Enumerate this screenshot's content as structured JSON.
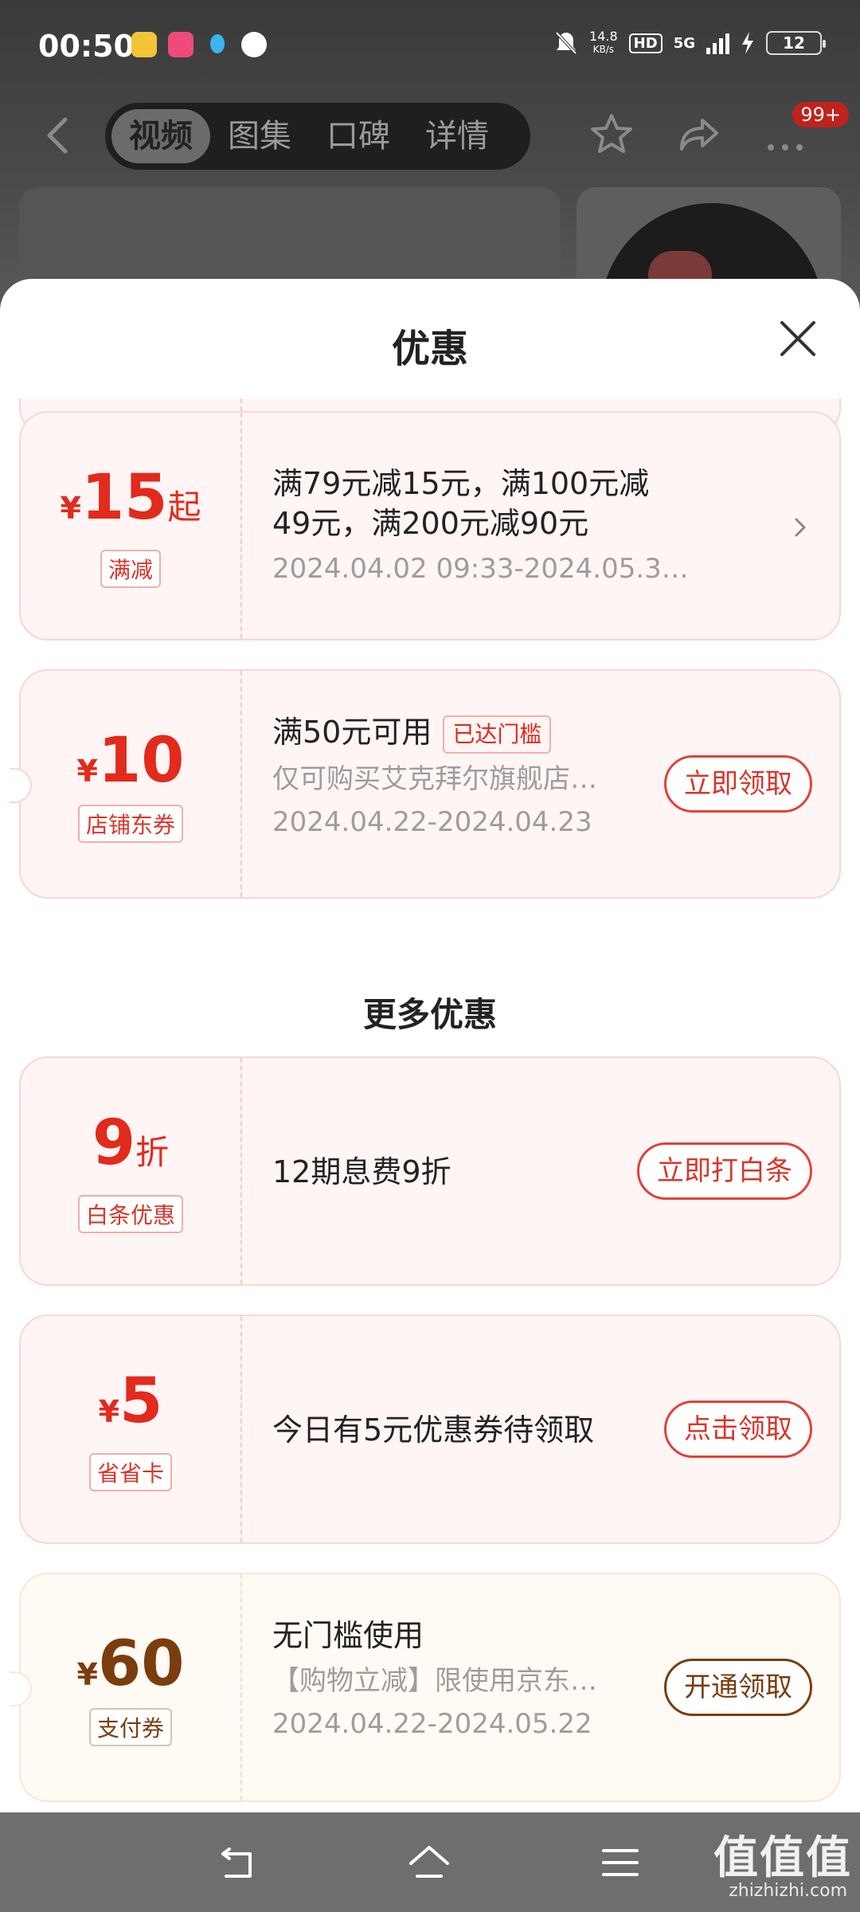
{
  "status_bar": {
    "time": "00:50",
    "net_speed_value": "14.8",
    "net_speed_unit": "KB/s",
    "hd": "HD",
    "network": "5G",
    "battery": "12"
  },
  "nav": {
    "tabs": [
      "视频",
      "图集",
      "口碑",
      "详情"
    ],
    "active_tab": "视频",
    "message_badge": "99+"
  },
  "sheet": {
    "title": "优惠"
  },
  "coupons": [
    {
      "currency": "¥",
      "amount": "15",
      "suffix": "起",
      "tag": "满减",
      "line1": "满79元减15元，满100元减",
      "line2": "49元，满200元减90元",
      "date": "2024.04.02 09:33-2024.05.3…"
    },
    {
      "currency": "¥",
      "amount": "10",
      "tag": "店铺东券",
      "line1": "满50元可用",
      "status": "已达门槛",
      "line2": "仅可购买艾克拜尔旗舰店…",
      "date": "2024.04.22-2024.04.23",
      "button": "立即领取"
    }
  ],
  "more_title": "更多优惠",
  "more_offers": [
    {
      "amount": "9",
      "suffix": "折",
      "tag": "白条优惠",
      "text": "12期息费9折",
      "button": "立即打白条"
    },
    {
      "currency": "¥",
      "amount": "5",
      "tag": "省省卡",
      "text": "今日有5元优惠券待领取",
      "button": "点击领取"
    },
    {
      "currency": "¥",
      "amount": "60",
      "tag": "支付券",
      "line1": "无门槛使用",
      "line2": "【购物立减】限使用京东…",
      "date": "2024.04.22-2024.05.22",
      "button": "开通领取"
    }
  ],
  "watermark": {
    "main": "值值值",
    "sub": "zhizhizhi.com"
  },
  "colors": {
    "accent_red": "#e22a1d",
    "gold_brown": "#7a3d0e",
    "coupon_bg": "#fff5f4"
  }
}
